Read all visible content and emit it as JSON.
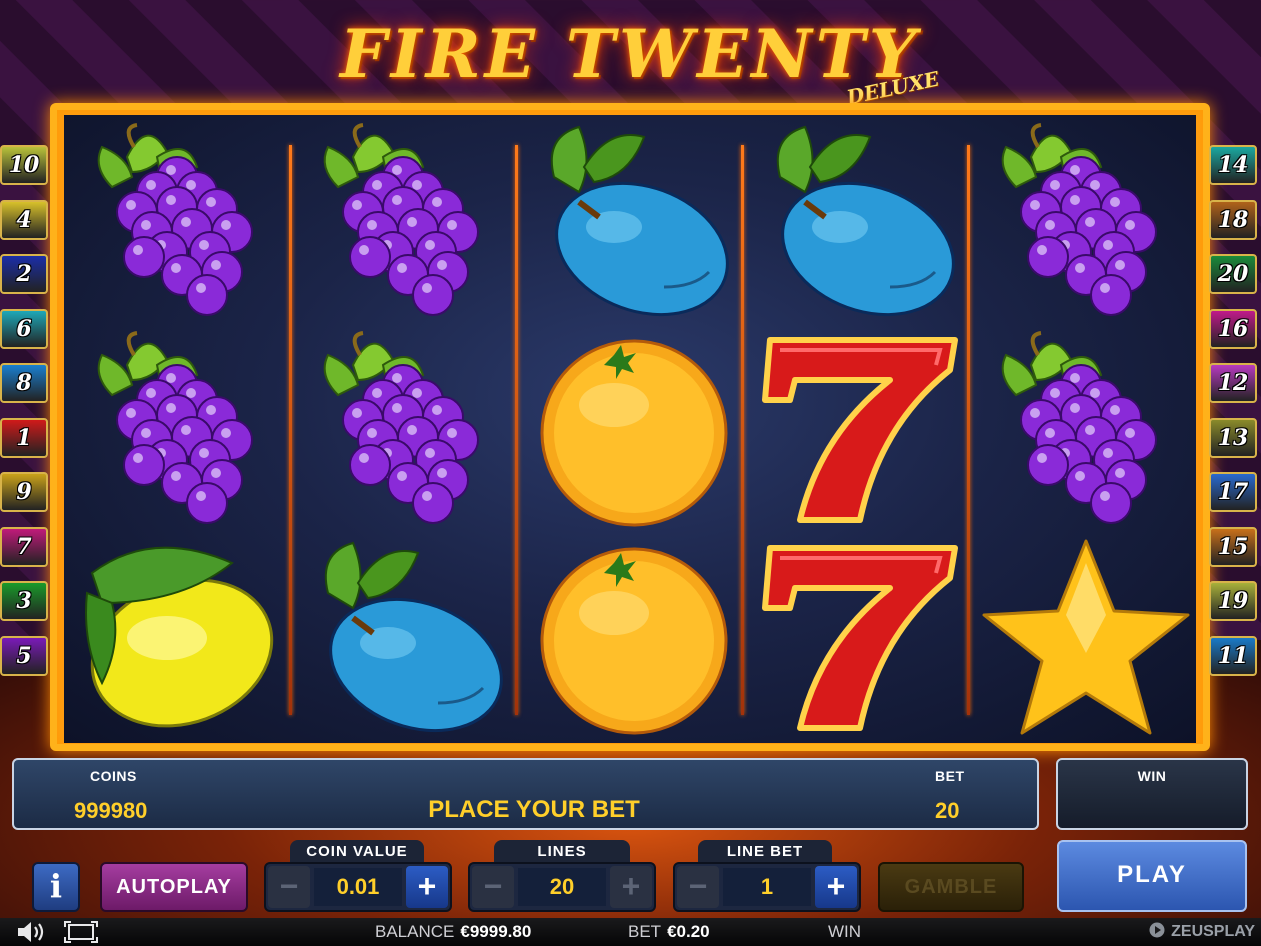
{
  "title": {
    "main": "FIRE TWENTY",
    "sub": "DELUXE"
  },
  "reels": [
    [
      "grapes",
      "grapes",
      "lemon"
    ],
    [
      "grapes",
      "grapes",
      "plum"
    ],
    [
      "plum",
      "orange",
      "orange"
    ],
    [
      "plum",
      "seven",
      "seven"
    ],
    [
      "grapes",
      "grapes",
      "star"
    ]
  ],
  "paylines": {
    "left": [
      "10",
      "4",
      "2",
      "6",
      "8",
      "1",
      "9",
      "7",
      "3",
      "5"
    ],
    "right": [
      "14",
      "18",
      "20",
      "16",
      "12",
      "13",
      "17",
      "15",
      "19",
      "11"
    ],
    "left_colors": [
      "#b9c23a",
      "#d8c12a",
      "#1b2ea8",
      "#1ea8b8",
      "#1a7fd0",
      "#d01a1a",
      "#c9a11a",
      "#c01a7a",
      "#1a9a2a",
      "#7a1ab8"
    ],
    "right_colors": [
      "#1aa8a0",
      "#b0621a",
      "#1a8a3a",
      "#c01a8a",
      "#b83ac0",
      "#8a8a2a",
      "#2a6ad0",
      "#c8701a",
      "#a8b03a",
      "#1a7ac8"
    ]
  },
  "info": {
    "coins_label": "COINS",
    "coins_value": "999980",
    "message": "PLACE YOUR BET",
    "bet_label": "BET",
    "bet_value": "20",
    "win_label": "WIN"
  },
  "controls": {
    "info_label": "i",
    "autoplay_label": "AUTOPLAY",
    "coin_value": {
      "label": "COIN VALUE",
      "value": "0.01"
    },
    "lines": {
      "label": "LINES",
      "value": "20"
    },
    "line_bet": {
      "label": "LINE BET",
      "value": "1"
    },
    "minus": "−",
    "plus": "+",
    "gamble_label": "GAMBLE",
    "play_label": "PLAY"
  },
  "status": {
    "balance_label": "BALANCE",
    "balance_value": "€9999.80",
    "bet_label": "BET",
    "bet_value": "€0.20",
    "win_label": "WIN",
    "brand": "ZEUSPLAY"
  },
  "icons": [
    "sound-icon",
    "fullscreen-icon"
  ]
}
